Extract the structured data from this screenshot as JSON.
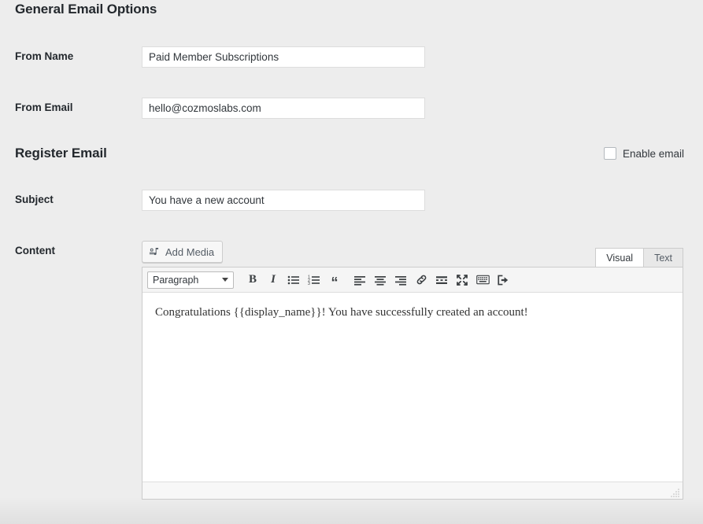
{
  "sections": {
    "general": {
      "title": "General Email Options",
      "fields": [
        {
          "label": "From Name",
          "value": "Paid Member Subscriptions",
          "placeholder": ""
        },
        {
          "label": "From Email",
          "value": "hello@cozmoslabs.com",
          "placeholder": ""
        }
      ]
    },
    "register": {
      "title": "Register Email",
      "enable": {
        "label": "Enable email",
        "checked": false
      },
      "subject": {
        "label": "Subject",
        "value": "You have a new account",
        "placeholder": ""
      },
      "content": {
        "label": "Content",
        "add_media_label": "Add Media",
        "add_media_icon": "media-icon",
        "tabs": [
          {
            "label": "Visual",
            "active": true
          },
          {
            "label": "Text",
            "active": false
          }
        ],
        "format_select": {
          "value": "Paragraph",
          "icon": "chevron-down-icon"
        },
        "toolbar_buttons": [
          {
            "name": "bold-icon",
            "glyph": "B",
            "title": "Bold"
          },
          {
            "name": "italic-icon",
            "glyph": "I",
            "title": "Italic"
          },
          {
            "name": "bulleted-list-icon",
            "glyph": "",
            "title": "Bulleted list"
          },
          {
            "name": "numbered-list-icon",
            "glyph": "",
            "title": "Numbered list"
          },
          {
            "name": "blockquote-icon",
            "glyph": "“",
            "title": "Blockquote"
          },
          {
            "name": "align-left-icon",
            "glyph": "",
            "title": "Align left"
          },
          {
            "name": "align-center-icon",
            "glyph": "",
            "title": "Align center"
          },
          {
            "name": "align-right-icon",
            "glyph": "",
            "title": "Align right"
          },
          {
            "name": "link-icon",
            "glyph": "",
            "title": "Insert/edit link"
          },
          {
            "name": "read-more-icon",
            "glyph": "",
            "title": "Insert Read More tag"
          },
          {
            "name": "fullscreen-icon",
            "glyph": "",
            "title": "Distraction-free writing mode"
          },
          {
            "name": "keyboard-icon",
            "glyph": "",
            "title": "Toolbar Toggle"
          },
          {
            "name": "exit-icon",
            "glyph": "",
            "title": "Exit"
          }
        ],
        "body_text": "Congratulations {{display_name}}! You have successfully created an account!",
        "resize_handle": "resize-grip-icon"
      }
    }
  },
  "colors": {
    "page_background": "#ededed",
    "input_background": "#ffffff",
    "input_border": "#dddddd",
    "text_dark": "#23282d",
    "toolbar_background": "#f5f5f5",
    "editor_border": "#cccccc"
  }
}
